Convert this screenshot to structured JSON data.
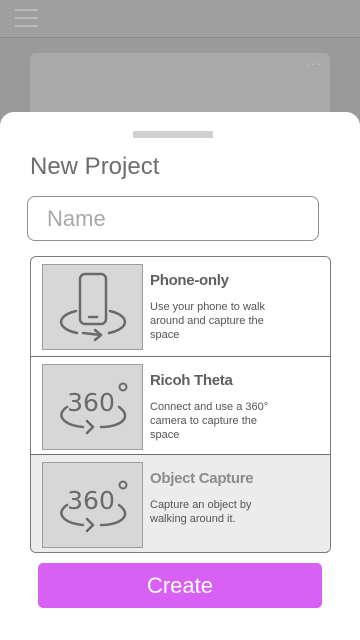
{
  "background": {
    "more_glyph": "···"
  },
  "sheet": {
    "title": "New Project",
    "name_placeholder": "Name",
    "options": [
      {
        "title": "Phone-only",
        "description": "Use your phone to walk around and capture the space",
        "icon": "phone-rotate-icon",
        "disabled": false
      },
      {
        "title": "Ricoh Theta",
        "description": "Connect and use a 360° camera to capture the space",
        "icon": "360-camera-icon",
        "disabled": false
      },
      {
        "title": "Object Capture",
        "description": "Capture an object by walking around it.",
        "icon": "360-object-icon",
        "disabled": true
      }
    ],
    "create_label": "Create"
  },
  "colors": {
    "accent": "#d960f4",
    "overlay": "#9a9a9a"
  }
}
